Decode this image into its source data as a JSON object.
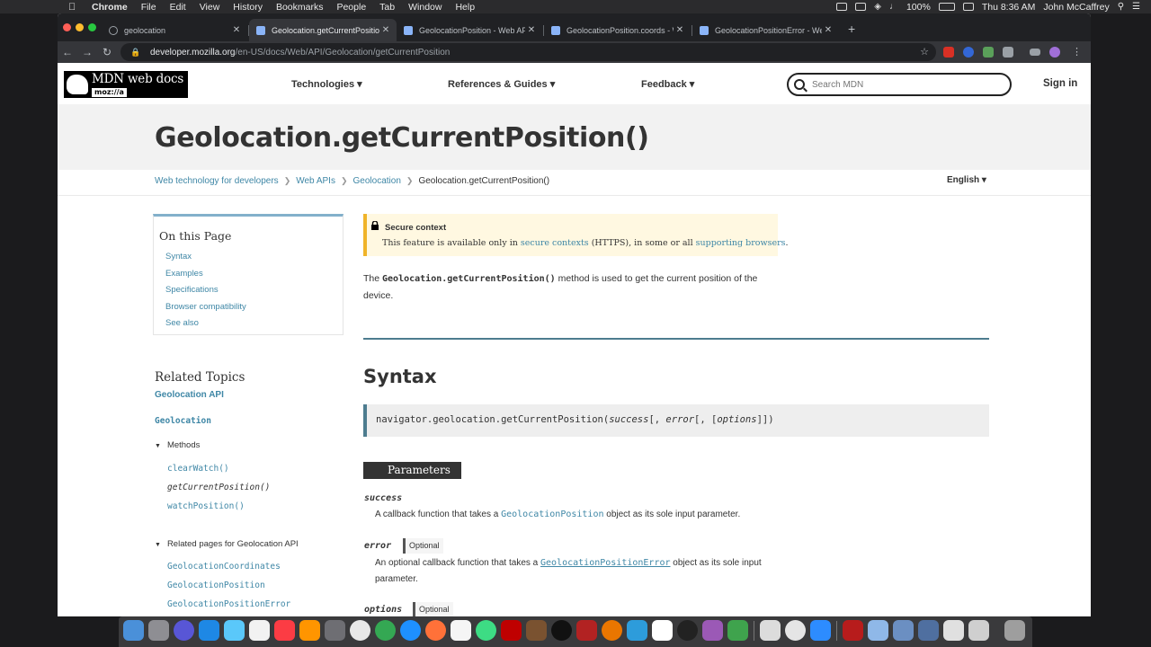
{
  "menubar": {
    "app": "Chrome",
    "items": [
      "File",
      "Edit",
      "View",
      "History",
      "Bookmarks",
      "People",
      "Tab",
      "Window",
      "Help"
    ],
    "battery": "100%",
    "clock": "Thu 8:36 AM",
    "user": "John McCaffrey"
  },
  "tabs": [
    {
      "title": "geolocation"
    },
    {
      "title": "Geolocation.getCurrentPositio"
    },
    {
      "title": "GeolocationPosition - Web API"
    },
    {
      "title": "GeolocationPosition.coords - W"
    },
    {
      "title": "GeolocationPositionError - Web"
    }
  ],
  "omnibox": {
    "domain": "developer.mozilla.org",
    "path": "/en-US/docs/Web/API/Geolocation/getCurrentPosition"
  },
  "header": {
    "logo_text": "MDN web docs",
    "logo_sub": "moz://a",
    "nav": [
      "Technologies ▾",
      "References & Guides ▾",
      "Feedback ▾"
    ],
    "search_placeholder": "Search MDN",
    "sign_in": "Sign in"
  },
  "page": {
    "title": "Geolocation.getCurrentPosition()",
    "breadcrumb": [
      "Web technology for developers",
      "Web APIs",
      "Geolocation",
      "Geolocation.getCurrentPosition()"
    ],
    "language": "English ▾"
  },
  "toc": {
    "title": "On this Page",
    "items": [
      "Syntax",
      "Examples",
      "Specifications",
      "Browser compatibility",
      "See also"
    ]
  },
  "related": {
    "title": "Related Topics",
    "api_link": "Geolocation API",
    "interface": "Geolocation",
    "methods_label": "Methods",
    "methods": [
      "clearWatch()",
      "getCurrentPosition()",
      "watchPosition()"
    ],
    "related_pages_label": "Related pages for Geolocation API",
    "related_pages": [
      "GeolocationCoordinates",
      "GeolocationPosition",
      "GeolocationPositionError"
    ]
  },
  "secure": {
    "title": "Secure context",
    "text_a": "This feature is available only in ",
    "link_a": "secure contexts",
    "text_b": " (HTTPS), in some or all ",
    "link_b": "supporting browsers",
    "text_c": "."
  },
  "intro": {
    "pre": "The ",
    "code": "Geolocation.getCurrentPosition()",
    "post": " method is used to get the current position of the device."
  },
  "syntax": {
    "heading": "Syntax",
    "code_prefix": "navigator.geolocation.getCurrentPosition(",
    "arg1": "success",
    "sep1": "[, ",
    "arg2": "error",
    "sep2": "[, [",
    "arg3": "options",
    "code_suffix": "]])"
  },
  "params": {
    "heading": "Parameters",
    "optional_label": "Optional",
    "success_name": "success",
    "success_pre": "A callback function that takes a ",
    "success_link": "GeolocationPosition",
    "success_post": " object as its sole input parameter.",
    "error_name": "error",
    "error_pre": "An optional callback function that takes a ",
    "error_link": "GeolocationPositionError",
    "error_post": " object as its sole input parameter.",
    "options_name": "options"
  },
  "colors": {
    "accent": "#3f87a6",
    "rule": "#4d7c8f",
    "secure_bg": "#fff8e1",
    "secure_border": "#f0b429"
  }
}
